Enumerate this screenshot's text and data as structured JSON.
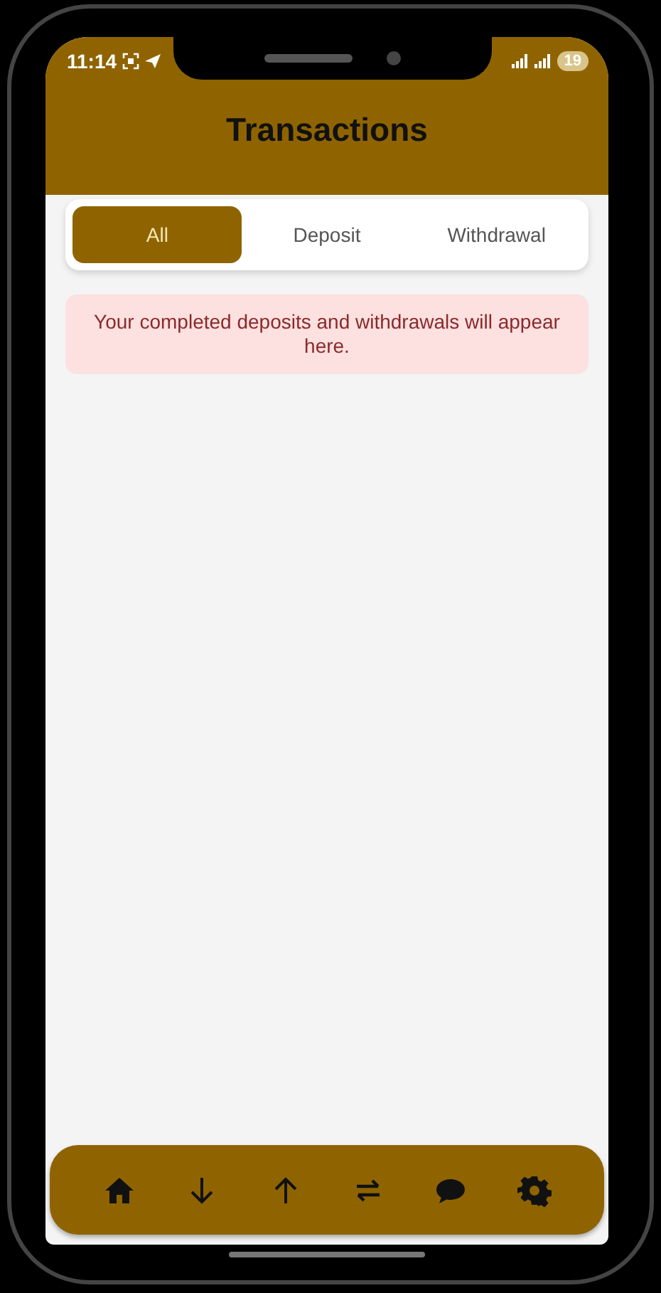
{
  "status_bar": {
    "time": "11:14",
    "battery": "19"
  },
  "header": {
    "title": "Transactions"
  },
  "tabs": [
    {
      "label": "All",
      "selected": true
    },
    {
      "label": "Deposit",
      "selected": false
    },
    {
      "label": "Withdrawal",
      "selected": false
    }
  ],
  "notice": {
    "text": "Your completed deposits and withdrawals will appear here."
  },
  "bottom_nav": [
    {
      "kind": "home"
    },
    {
      "kind": "down"
    },
    {
      "kind": "up"
    },
    {
      "kind": "transfer"
    },
    {
      "kind": "chat"
    },
    {
      "kind": "settings"
    }
  ]
}
